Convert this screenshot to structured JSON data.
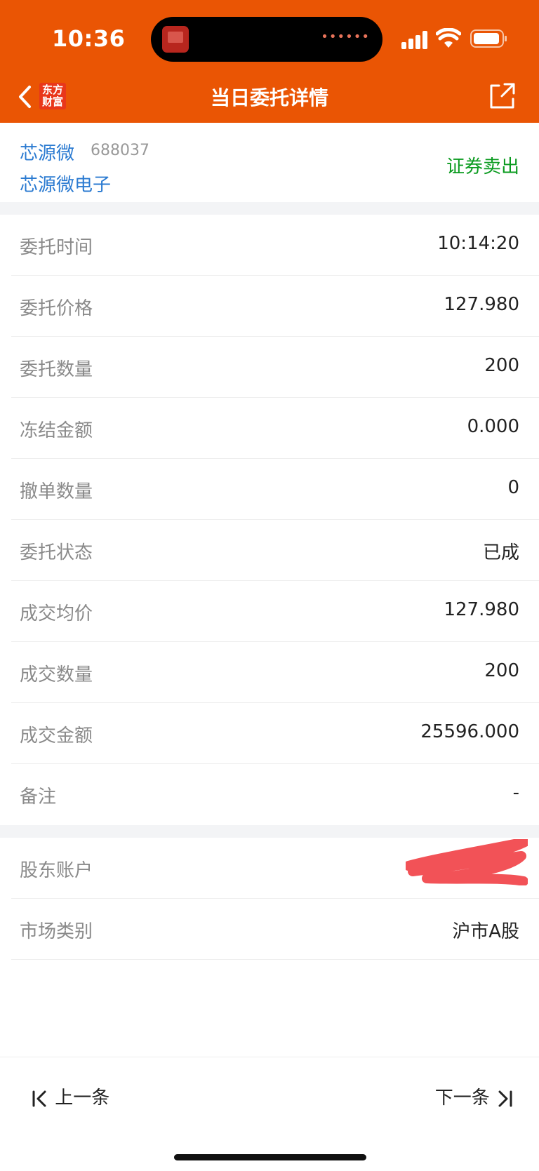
{
  "status_bar": {
    "time": "10:36"
  },
  "header": {
    "title": "当日委托详情",
    "logo_line1": "东方",
    "logo_line2": "财富"
  },
  "stock": {
    "name": "芯源微",
    "code": "688037",
    "full_name": "芯源微电子",
    "trade_type": "证券卖出"
  },
  "details": [
    {
      "label": "委托时间",
      "value": "10:14:20"
    },
    {
      "label": "委托价格",
      "value": "127.980"
    },
    {
      "label": "委托数量",
      "value": "200"
    },
    {
      "label": "冻结金额",
      "value": "0.000"
    },
    {
      "label": "撤单数量",
      "value": "0"
    },
    {
      "label": "委托状态",
      "value": "已成"
    },
    {
      "label": "成交均价",
      "value": "127.980"
    },
    {
      "label": "成交数量",
      "value": "200"
    },
    {
      "label": "成交金额",
      "value": "25596.000"
    },
    {
      "label": "备注",
      "value": "-"
    }
  ],
  "account": [
    {
      "label": "股东账户",
      "value": ""
    },
    {
      "label": "市场类别",
      "value": "沪市A股"
    }
  ],
  "footer": {
    "prev_label": "上一条",
    "next_label": "下一条"
  },
  "colors": {
    "brand": "#ea5504",
    "link": "#2a7ad1",
    "sell": "#0a9b1f"
  }
}
